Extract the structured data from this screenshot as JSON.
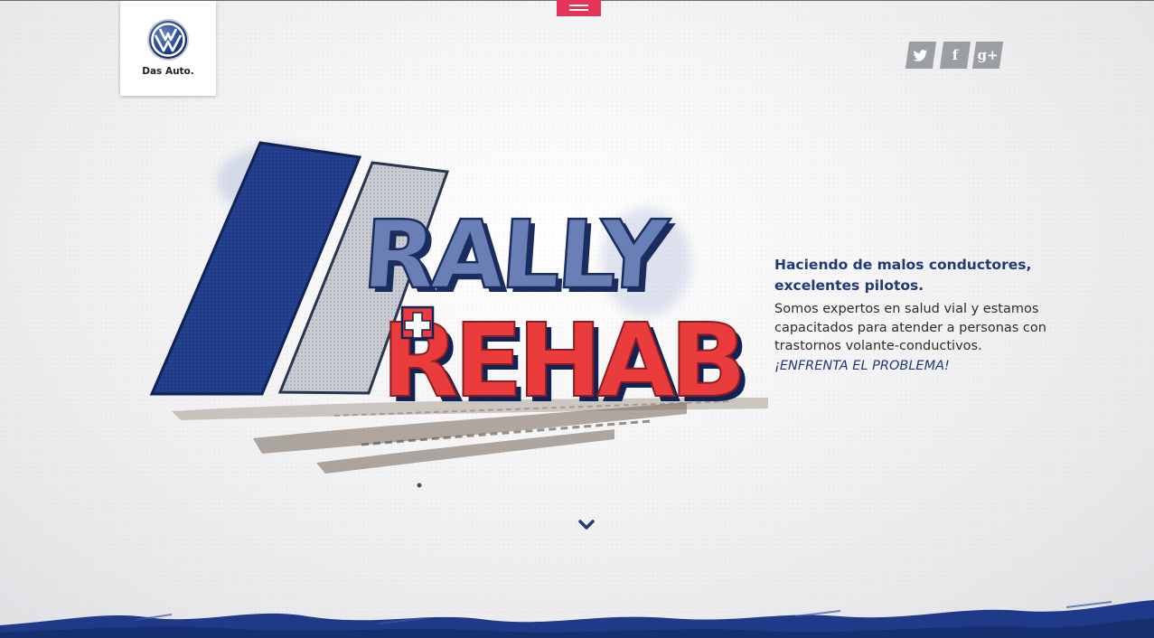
{
  "brand": {
    "logo_text": "Das Auto."
  },
  "nav": {
    "menu_icon": "hamburger-icon"
  },
  "social": [
    {
      "name": "twitter",
      "glyph": "t"
    },
    {
      "name": "facebook",
      "glyph": "f"
    },
    {
      "name": "google-plus",
      "glyph": "g+"
    }
  ],
  "hero": {
    "headline": "Haciendo de malos conductores, excelentes pilotos.",
    "body": "Somos expertos en salud vial y estamos capacitados para atender a personas con trastornos volante-conductivos.",
    "cta": "¡ENFRENTA EL PROBLEMA!",
    "title_line1": "RALLY",
    "title_line2": "REHAB"
  },
  "colors": {
    "accent": "#e5335a",
    "brand_blue": "#1f3a78",
    "rally_blue": "#5a70a8",
    "rehab_red": "#e8373a"
  },
  "scroll_icon": "chevron-down-icon"
}
